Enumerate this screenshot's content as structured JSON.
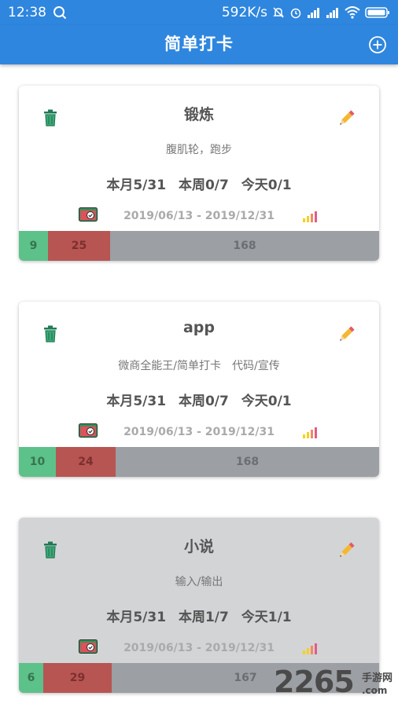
{
  "status_bar": {
    "time": "12:38",
    "network_speed": "592K/s",
    "icons": [
      "search-icon",
      "mute-icon",
      "alarm-icon",
      "signal-icon",
      "signal-icon",
      "wifi-icon",
      "battery-icon"
    ]
  },
  "app_bar": {
    "title": "简单打卡",
    "add_icon": "add-circle-icon",
    "color": "#2e86de"
  },
  "cards": [
    {
      "name": "锻炼",
      "description": "腹肌轮，跑步",
      "month": "本月5/31",
      "week": "本周0/7",
      "today": "今天0/1",
      "date_range": "2019/06/13 - 2019/12/31",
      "progress": {
        "done": "9",
        "missed": "25",
        "remaining": "168"
      }
    },
    {
      "name": "app",
      "description": "微商全能王/简单打卡　代码/宣传",
      "month": "本月5/31",
      "week": "本周0/7",
      "today": "今天0/1",
      "date_range": "2019/06/13 - 2019/12/31",
      "progress": {
        "done": "10",
        "missed": "24",
        "remaining": "168"
      }
    },
    {
      "name": "小说",
      "description": "输入/输出",
      "month": "本月5/31",
      "week": "本周1/7",
      "today": "今天1/1",
      "date_range": "2019/06/13 - 2019/12/31",
      "progress": {
        "done": "6",
        "missed": "29",
        "remaining": "167"
      }
    }
  ],
  "colors": {
    "done": "#5dc18a",
    "missed": "#b75553",
    "remaining": "#9c9fa3"
  },
  "watermark": {
    "number": "2265",
    "text": "手游网",
    "domain": ".com"
  }
}
